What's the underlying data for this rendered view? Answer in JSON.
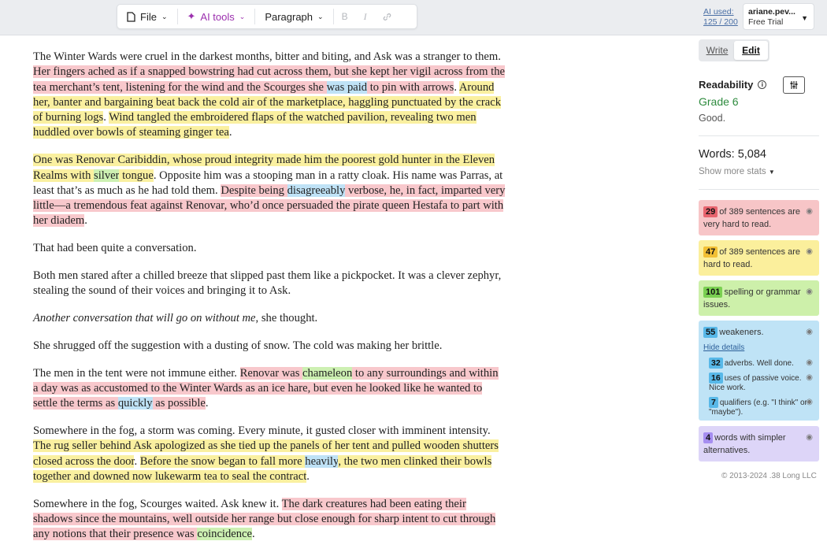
{
  "toolbar": {
    "file": "File",
    "ai_tools": "AI tools",
    "paragraph": "Paragraph",
    "bold": "B",
    "italic": "I",
    "link": "🔗"
  },
  "account": {
    "ai_used_label": "AI used:",
    "ai_used_value": "125 / 200",
    "user": "ariane.pev...",
    "plan": "Free Trial"
  },
  "mode": {
    "write": "Write",
    "edit": "Edit"
  },
  "readability": {
    "title": "Readability",
    "grade": "Grade 6",
    "desc": "Good.",
    "words": "Words: 5,084",
    "more_stats": "Show more stats"
  },
  "cards": {
    "very_hard": {
      "count": "29",
      "text": "of 389 sentences are very hard to read."
    },
    "hard": {
      "count": "47",
      "text": "of 389 sentences are hard to read."
    },
    "spelling": {
      "count": "101",
      "text": "spelling or grammar issues."
    },
    "weakeners": {
      "count": "55",
      "text": "weakeners.",
      "hide": "Hide details",
      "adverbs_count": "32",
      "adverbs_text": "adverbs. Well done.",
      "passive_count": "16",
      "passive_text": "uses of passive voice. Nice work.",
      "qualifiers_count": "7",
      "qualifiers_text": "qualifiers (e.g. \"I think\" or \"maybe\")."
    },
    "simpler": {
      "count": "4",
      "text": "words with simpler alternatives."
    }
  },
  "copyright": "© 2013-2024 .38 Long LLC",
  "doc": {
    "p1": [
      "The Winter Wards were cruel in the darkest months, bitter and biting, and Ask was a stranger to them. ",
      "Her fingers ached as if a snapped bowstring had cut across them, but she kept her vigil across from the tea merchant’s tent, listening for the wind and the Scourges she ",
      "was paid",
      " to pin with arrows",
      ". ",
      "Around her, banter and bargaining beat back the cold air of the marketplace, haggling punctuated by the crack of burning logs",
      ". ",
      "Wind tangled the embroidered flaps of the watched pavilion, revealing two men huddled over bowls of steaming ginger tea",
      "."
    ],
    "p2": [
      "One was Renovar Caribiddin, whose proud integrity made him the poorest gold hunter in the Eleven Realms with ",
      "silver",
      " tongue",
      ". Opposite him was a stooping man in a ratty cloak. His name was Parras, at least that’s as much as he had told them. ",
      "Despite being ",
      "disagreeably",
      " verbose, he, in fact, imparted very little—a tremendous feat against Renovar, who’d once persuaded the pirate queen Hestafa to part with her diadem",
      "."
    ],
    "p3": "That had been quite a conversation.",
    "p4": "Both men stared after a chilled breeze that slipped past them like a pickpocket. It was a clever zephyr, stealing the sound of their voices and bringing it to Ask.",
    "p5_italic": "Another conversation that will go on without me",
    "p5_rest": ", she thought.",
    "p6": "She shrugged off the suggestion with a dusting of snow. The cold was making her brittle.",
    "p7": [
      "The men in the tent were not immune either. ",
      "Renovar was ",
      "chameleon",
      " to any surroundings and within a day was as accustomed to the Winter Wards as an ice hare, but even he looked like he wanted to settle the terms as ",
      "quickly",
      " as possible",
      "."
    ],
    "p8": [
      "Somewhere in the fog, a storm was coming. Every minute, it gusted closer with imminent intensity. ",
      "The rug seller behind Ask apologized as she tied up the panels of her tent and pulled wooden shutters closed across the door",
      ". ",
      "Before the snow began to fall more ",
      "heavily",
      ", the two men clinked their bowls together and downed now lukewarm tea to seal the contract",
      "."
    ],
    "p9": [
      "Somewhere in the fog, Scourges waited. Ask knew it. ",
      "The dark creatures had been eating their shadows since the mountains, well outside her range but close enough for sharp intent to cut through any notions that their presence was ",
      "coincidence",
      "."
    ]
  }
}
